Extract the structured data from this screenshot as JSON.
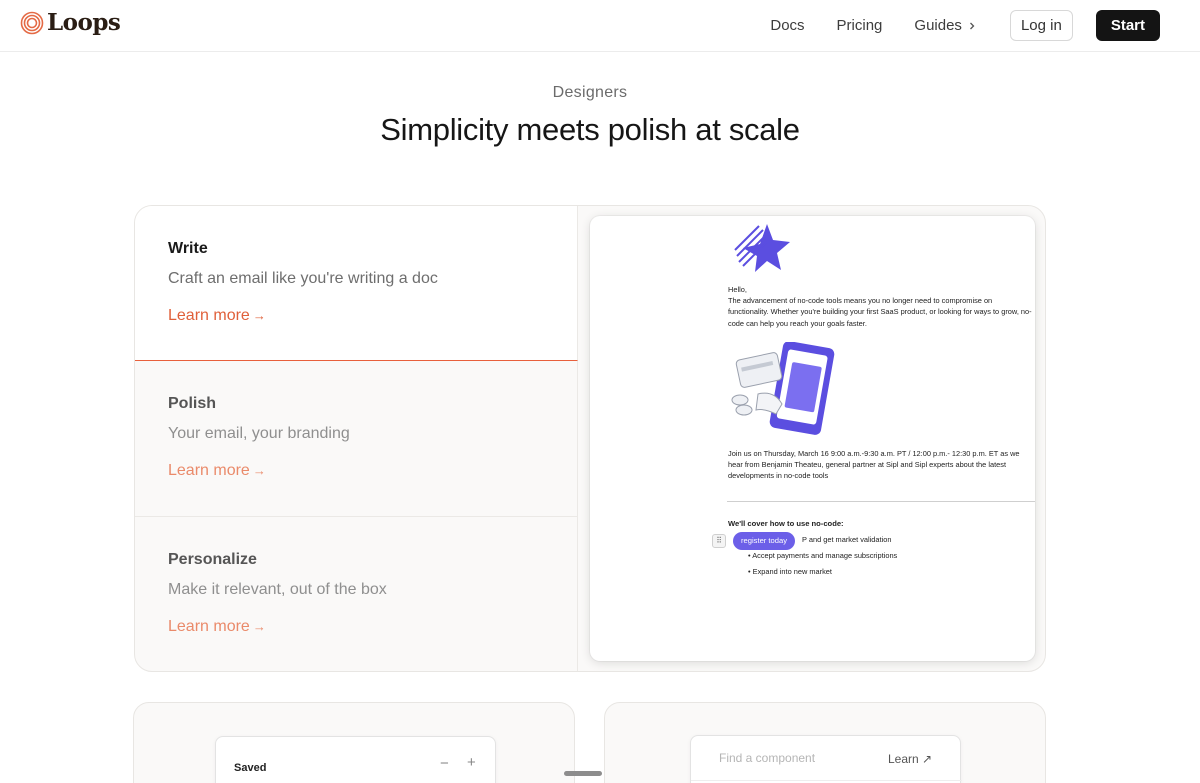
{
  "header": {
    "logo_text": "Loops",
    "nav": {
      "docs": "Docs",
      "pricing": "Pricing",
      "guides": "Guides",
      "login": "Log in",
      "start": "Start"
    }
  },
  "section": {
    "eyebrow": "Designers",
    "headline": "Simplicity meets polish at scale"
  },
  "features": [
    {
      "title": "Write",
      "description": "Craft an email like you're writing a doc",
      "link": "Learn more",
      "arrow": "→"
    },
    {
      "title": "Polish",
      "description": "Your email, your branding",
      "link": "Learn more",
      "arrow": "→"
    },
    {
      "title": "Personalize",
      "description": "Make it relevant, out of the box",
      "link": "Learn more",
      "arrow": "→"
    }
  ],
  "preview": {
    "greeting": "Hello,",
    "paragraph1": "The advancement of no-code tools means you no longer need to compromise on functionality. Whether you're building your first SaaS product, or looking for ways to grow, no-code can help you reach your goals faster.",
    "paragraph2": "Join us on Thursday, March 16  9:00 a.m.-9:30 a.m. PT / 12:00 p.m.- 12:30 p.m. ET as we hear from Benjamin Theateu, general partner at Sipl and Sipl experts about the latest developments in no-code tools",
    "cover_title": "We'll cover how to use no-code:",
    "bullet1_partial": "P and get market validation",
    "bullet2": "• Accept payments and manage subscriptions",
    "bullet3": "• Expand into new market",
    "register_pill": "register today",
    "accent": "#6c5fe8"
  },
  "lower": {
    "saved_label": "Saved",
    "minus": "−",
    "plus": "+",
    "search_placeholder": "Find a component",
    "learn": "Learn ↗"
  },
  "colors": {
    "accent_orange": "#e0603a",
    "illustration_purple": "#5b4ee0",
    "button_dark": "#141414"
  }
}
